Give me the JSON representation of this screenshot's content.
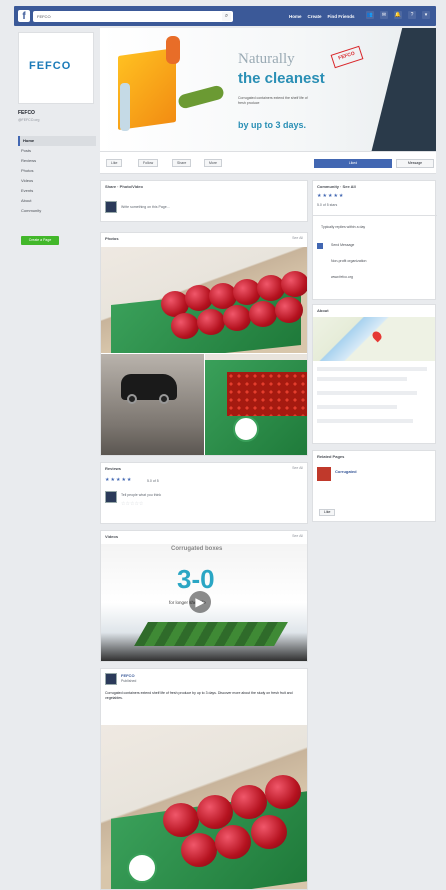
{
  "topbar": {
    "search_value": "FEFCO",
    "nav": [
      "Home",
      "Create",
      "Find Friends"
    ]
  },
  "page": {
    "logo_text": "FEFCO",
    "name": "FEFCO",
    "handle": "@FEFCO.org",
    "left_nav": [
      "Home",
      "Posts",
      "Reviews",
      "Photos",
      "Videos",
      "Events",
      "About",
      "Community"
    ],
    "create_label": "Create a Page"
  },
  "cover": {
    "line1": "Naturally",
    "line2": "the cleanest",
    "stamp": "FEFCO",
    "paragraph": "Corrugated containers extend the shelf life of fresh produce",
    "big": "by up to 3 days."
  },
  "actions": [
    "Like",
    "Follow",
    "Share",
    "More"
  ],
  "like_page_label": "Liked",
  "message_label": "Message",
  "composer": {
    "header": "Share · Photo/Video",
    "placeholder": "Write something on this Page..."
  },
  "photos": {
    "header": "Photos",
    "see_all": "See All"
  },
  "reviews": {
    "header": "Reviews",
    "see_all": "See All",
    "score": "5.0 of 5",
    "reviewer": "Tell people what you think"
  },
  "videos": {
    "header": "Videos",
    "see_all": "See All",
    "video_title": "Corrugated boxes",
    "score": "3-0",
    "subtitle": "for longer shelf life"
  },
  "post": {
    "author": "FEFCO",
    "date": "Published",
    "text": "Corrugated containers extend shelf life of fresh produce by up to 3 days. Discover more about the study on fresh fruit and vegetables."
  },
  "right": {
    "community_header": "Community · See All",
    "rating": "5.0 of 5 stars",
    "about_header": "About",
    "about_items": [
      "Typically replies within a day",
      "Send Message",
      "Non-profit organization",
      "www.fefco.org"
    ],
    "related_header": "Related Pages",
    "related_name": "Corrugated",
    "related_like": "Like"
  },
  "icons": {
    "search": "search-icon",
    "play": "play-icon",
    "star": "star-icon"
  }
}
